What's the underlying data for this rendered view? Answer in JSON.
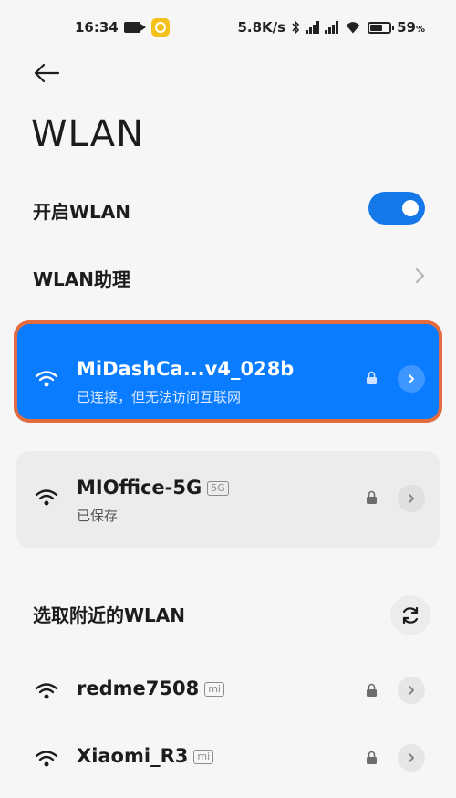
{
  "status_bar": {
    "time": "16:34",
    "net_speed": "5.8K/s",
    "battery_pct": "59",
    "battery_unit": "%"
  },
  "header": {
    "title": "WLAN"
  },
  "settings": {
    "enable_label": "开启WLAN",
    "enable_on": true,
    "assistant_label": "WLAN助理"
  },
  "connected": {
    "name": "MiDashCa...v4_028b",
    "status": "已连接，但无法访问互联网"
  },
  "saved": {
    "name": "MIOffice-5G",
    "badge": "5G",
    "status": "已保存"
  },
  "nearby": {
    "title": "选取附近的WLAN",
    "items": [
      {
        "name": "redme7508",
        "badge": "mi"
      },
      {
        "name": "Xiaomi_R3",
        "badge": "mi"
      }
    ]
  },
  "colors": {
    "accent": "#0a7cff",
    "highlight_outline": "#e36b3e",
    "background": "#f6f6f6"
  }
}
